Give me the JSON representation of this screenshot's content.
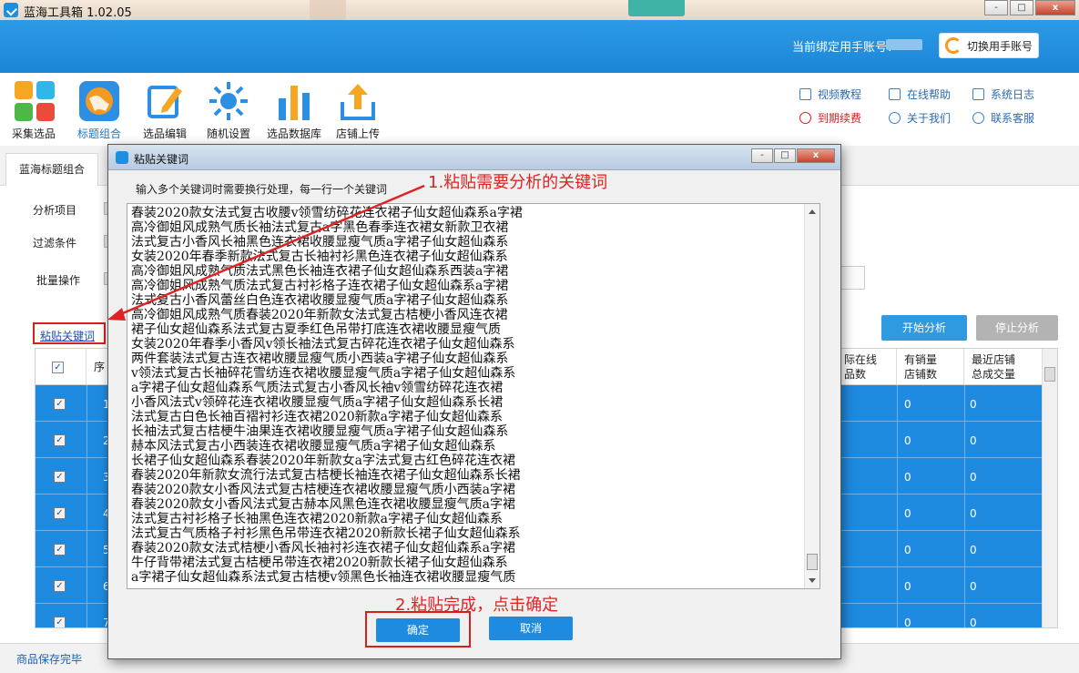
{
  "app": {
    "title": "蓝海工具箱 1.02.05"
  },
  "window_buttons": {
    "minimize": "-",
    "maximize": "□",
    "close": "x"
  },
  "header": {
    "account_label": "当前绑定用手账号：",
    "switch_button": "切换用手账号"
  },
  "toolbar": {
    "tools": [
      {
        "label": "采集选品",
        "icon": "four-squares-icon"
      },
      {
        "label": "标题组合",
        "icon": "globe-icon"
      },
      {
        "label": "选品编辑",
        "icon": "edit-icon"
      },
      {
        "label": "随机设置",
        "icon": "sun-icon"
      },
      {
        "label": "选品数据库",
        "icon": "bars-icon"
      },
      {
        "label": "店铺上传",
        "icon": "upload-icon"
      }
    ],
    "links_col1": [
      {
        "label": "视频教程",
        "icon": "video-icon"
      },
      {
        "label": "到期续费",
        "icon": "yen-icon"
      }
    ],
    "links_col2": [
      {
        "label": "在线帮助",
        "icon": "help-icon"
      },
      {
        "label": "关于我们",
        "icon": "info-icon"
      }
    ],
    "links_col3": [
      {
        "label": "系统日志",
        "icon": "log-icon"
      },
      {
        "label": "联系客服",
        "icon": "service-icon"
      }
    ]
  },
  "main": {
    "tab": "蓝海标题组合",
    "rows": {
      "analysis_item": "分析项目",
      "filter": "过滤条件",
      "batch": "批量操作"
    },
    "paste_link": "粘贴关键词",
    "start_button": "开始分析",
    "stop_button": "停止分析",
    "grid": {
      "headers": {
        "index": "序",
        "online": "际在线\n品数",
        "sales_shops": "有销量\n店铺数",
        "recent_volume": "最近店铺\n总成交量"
      },
      "rows": [
        {
          "idx": "1",
          "a": "0",
          "b": "0"
        },
        {
          "idx": "2",
          "a": "0",
          "b": "0"
        },
        {
          "idx": "3",
          "a": "0",
          "b": "0"
        },
        {
          "idx": "4",
          "a": "0",
          "b": "0"
        },
        {
          "idx": "5",
          "a": "0",
          "b": "0"
        },
        {
          "idx": "6",
          "a": "0",
          "b": "0"
        },
        {
          "idx": "7",
          "a": "0",
          "b": "0"
        }
      ]
    }
  },
  "status": "商品保存完毕",
  "dialog": {
    "title": "粘贴关键词",
    "hint": "输入多个关键词时需要换行处理，每一行一个关键词",
    "keywords": [
      "春装2020款女法式复古收腰v领雪纺碎花连衣裙子仙女超仙森系a字裙",
      "高冷御姐风成熟气质长袖法式复古a字黑色春季连衣裙女新款卫衣裙",
      "法式复古小香风长袖黑色连衣裙收腰显瘦气质a字裙子仙女超仙森系",
      "女装2020年春季新款法式复古长袖衬衫黑色连衣裙子仙女超仙森系",
      "高冷御姐风成熟气质法式黑色长袖连衣裙子仙女超仙森系西装a字裙",
      "高冷御姐风成熟气质法式复古衬衫格子连衣裙子仙女超仙森系a字裙",
      "法式复古小香风蕾丝白色连衣裙收腰显瘦气质a字裙子仙女超仙森系",
      "高冷御姐风成熟气质春装2020年新款女法式复古桔梗小香风连衣裙",
      "裙子仙女超仙森系法式复古夏季红色吊带打底连衣裙收腰显瘦气质",
      "女装2020年春季小香风v领长袖法式复古碎花连衣裙子仙女超仙森系",
      "两件套装法式复古连衣裙收腰显瘦气质小西装a字裙子仙女超仙森系",
      "v领法式复古长袖碎花雪纺连衣裙收腰显瘦气质a字裙子仙女超仙森系",
      "a字裙子仙女超仙森系气质法式复古小香风长袖v领雪纺碎花连衣裙",
      "小香风法式v领碎花连衣裙收腰显瘦气质a字裙子仙女超仙森系长裙",
      "法式复古白色长袖百褶衬衫连衣裙2020新款a字裙子仙女超仙森系",
      "长袖法式复古桔梗牛油果连衣裙收腰显瘦气质a字裙子仙女超仙森系",
      "赫本风法式复古小西装连衣裙收腰显瘦气质a字裙子仙女超仙森系",
      "长裙子仙女超仙森系春装2020年新款女a字法式复古红色碎花连衣裙",
      "春装2020年新款女流行法式复古桔梗长袖连衣裙子仙女超仙森系长裙",
      "春装2020款女小香风法式复古桔梗连衣裙收腰显瘦气质小西装a字裙",
      "春装2020款女小香风法式复古赫本风黑色连衣裙收腰显瘦气质a字裙",
      "法式复古衬衫格子长袖黑色连衣裙2020新款a字裙子仙女超仙森系",
      "法式复古气质格子衬衫黑色吊带连衣裙2020新款长裙子仙女超仙森系",
      "春装2020款女法式桔梗小香风长袖衬衫连衣裙子仙女超仙森系a字裙",
      "牛仔背带裙法式复古桔梗吊带连衣裙2020新款长裙子仙女超仙森系",
      "a字裙子仙女超仙森系法式复古桔梗v领黑色长袖连衣裙收腰显瘦气质"
    ],
    "ok_button": "确定",
    "cancel_button": "取消"
  },
  "annotations": {
    "step1": "1.粘贴需要分析的关键词",
    "step2": "2.粘贴完成，点击确定"
  },
  "colors": {
    "accent": "#1f8be0",
    "header": "#2c9ae6",
    "annotation": "#d71f1f"
  }
}
